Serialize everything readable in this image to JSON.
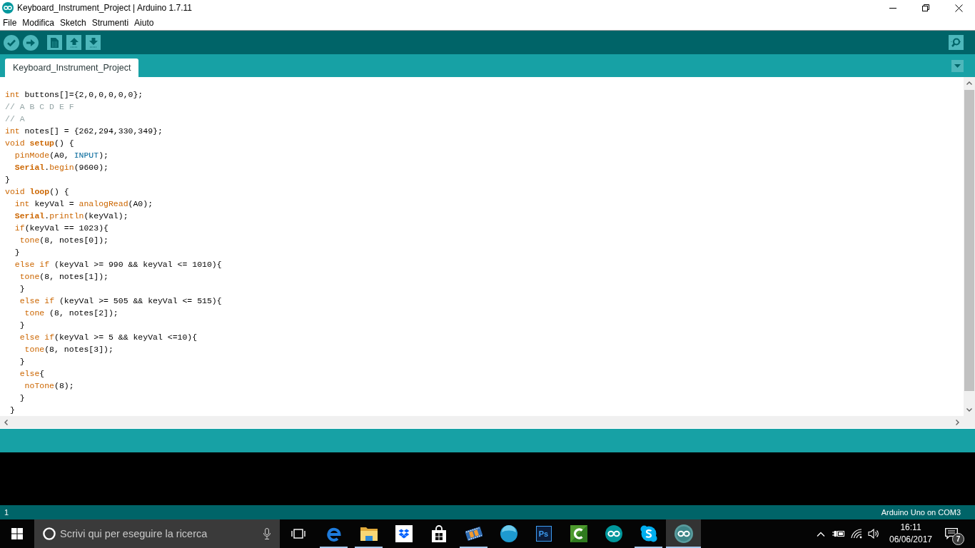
{
  "window": {
    "title": "Keyboard_Instrument_Project | Arduino 1.7.11"
  },
  "menu": [
    "File",
    "Modifica",
    "Sketch",
    "Strumenti",
    "Aiuto"
  ],
  "tabs": [
    {
      "label": "Keyboard_Instrument_Project",
      "selected": true
    }
  ],
  "editor": {
    "lines": [
      {
        "tokens": [
          {
            "text": "int",
            "kind": "keyword"
          },
          {
            "text": " buttons[]={2,0,0,0,0,0};",
            "kind": "plain"
          }
        ]
      },
      {
        "tokens": [
          {
            "text": "// A B C D E F",
            "kind": "comment"
          }
        ]
      },
      {
        "tokens": [
          {
            "text": "// A",
            "kind": "comment"
          }
        ]
      },
      {
        "tokens": [
          {
            "text": "int",
            "kind": "keyword"
          },
          {
            "text": " notes[] = {262,294,330,349};",
            "kind": "plain"
          }
        ]
      },
      {
        "tokens": [
          {
            "text": "void ",
            "kind": "keyword"
          },
          {
            "text": "setup",
            "kind": "emphasis"
          },
          {
            "text": "() {",
            "kind": "plain"
          }
        ]
      },
      {
        "tokens": [
          {
            "text": "  pinMode",
            "kind": "keyword"
          },
          {
            "text": "(A0, ",
            "kind": "plain"
          },
          {
            "text": "INPUT",
            "kind": "constant"
          },
          {
            "text": ");",
            "kind": "plain"
          }
        ]
      },
      {
        "tokens": [
          {
            "text": "  Serial",
            "kind": "emphasis"
          },
          {
            "text": ".",
            "kind": "plain"
          },
          {
            "text": "begin",
            "kind": "keyword"
          },
          {
            "text": "(9600);",
            "kind": "plain"
          }
        ]
      },
      {
        "tokens": [
          {
            "text": "}",
            "kind": "plain"
          }
        ]
      },
      {
        "tokens": [
          {
            "text": "void ",
            "kind": "keyword"
          },
          {
            "text": "loop",
            "kind": "emphasis"
          },
          {
            "text": "() {",
            "kind": "plain"
          }
        ]
      },
      {
        "tokens": [
          {
            "text": "  int",
            "kind": "keyword"
          },
          {
            "text": " keyVal = ",
            "kind": "plain"
          },
          {
            "text": "analogRead",
            "kind": "keyword"
          },
          {
            "text": "(A0);",
            "kind": "plain"
          }
        ]
      },
      {
        "tokens": [
          {
            "text": "  Serial",
            "kind": "emphasis"
          },
          {
            "text": ".",
            "kind": "plain"
          },
          {
            "text": "println",
            "kind": "keyword"
          },
          {
            "text": "(keyVal);",
            "kind": "plain"
          }
        ]
      },
      {
        "tokens": [
          {
            "text": "  if",
            "kind": "keyword"
          },
          {
            "text": "(keyVal == 1023){",
            "kind": "plain"
          }
        ]
      },
      {
        "tokens": [
          {
            "text": "   tone",
            "kind": "keyword"
          },
          {
            "text": "(8, notes[0]);",
            "kind": "plain"
          }
        ]
      },
      {
        "tokens": [
          {
            "text": "  }",
            "kind": "plain"
          }
        ]
      },
      {
        "tokens": [
          {
            "text": "  else if",
            "kind": "keyword"
          },
          {
            "text": " (keyVal >= 990 && keyVal <= 1010){",
            "kind": "plain"
          }
        ]
      },
      {
        "tokens": [
          {
            "text": "   tone",
            "kind": "keyword"
          },
          {
            "text": "(8, notes[1]);",
            "kind": "plain"
          }
        ]
      },
      {
        "tokens": [
          {
            "text": "   }",
            "kind": "plain"
          }
        ]
      },
      {
        "tokens": [
          {
            "text": "   else if",
            "kind": "keyword"
          },
          {
            "text": " (keyVal >= 505 && keyVal <= 515){",
            "kind": "plain"
          }
        ]
      },
      {
        "tokens": [
          {
            "text": "    tone",
            "kind": "keyword"
          },
          {
            "text": " (8, notes[2]);",
            "kind": "plain"
          }
        ]
      },
      {
        "tokens": [
          {
            "text": "   }",
            "kind": "plain"
          }
        ]
      },
      {
        "tokens": [
          {
            "text": "   else if",
            "kind": "keyword"
          },
          {
            "text": "(keyVal >= 5 && keyVal <=10){",
            "kind": "plain"
          }
        ]
      },
      {
        "tokens": [
          {
            "text": "    tone",
            "kind": "keyword"
          },
          {
            "text": "(8, notes[3]);",
            "kind": "plain"
          }
        ]
      },
      {
        "tokens": [
          {
            "text": "   }",
            "kind": "plain"
          }
        ]
      },
      {
        "tokens": [
          {
            "text": "   else",
            "kind": "keyword"
          },
          {
            "text": "{",
            "kind": "plain"
          }
        ]
      },
      {
        "tokens": [
          {
            "text": "    noTone",
            "kind": "keyword"
          },
          {
            "text": "(8);",
            "kind": "plain"
          }
        ]
      },
      {
        "tokens": [
          {
            "text": "   }",
            "kind": "plain"
          }
        ]
      },
      {
        "tokens": [
          {
            "text": " }",
            "kind": "plain"
          }
        ]
      }
    ]
  },
  "status_bar": {
    "line": "1",
    "board": "Arduino Uno on COM3"
  },
  "taskbar": {
    "search": {
      "placeholder": "Scrivi qui per eseguire la ricerca"
    },
    "apps": [
      {
        "kind": "letter_e",
        "running": true,
        "selected": false
      },
      {
        "kind": "folder",
        "running": true,
        "selected": false
      },
      {
        "kind": "box",
        "running": false,
        "selected": false
      },
      {
        "kind": "bag",
        "running": false,
        "selected": false
      },
      {
        "kind": "film",
        "running": true,
        "selected": false
      },
      {
        "kind": "sphere",
        "running": false,
        "selected": false
      },
      {
        "kind": "ps_tile",
        "label": "Ps",
        "running": false,
        "selected": false
      },
      {
        "kind": "c_tile",
        "running": false,
        "selected": false
      },
      {
        "kind": "infinity_teal",
        "running": false,
        "selected": false
      },
      {
        "kind": "s_bubble",
        "running": true,
        "selected": false
      },
      {
        "kind": "infinity_grey",
        "running": true,
        "selected": true
      }
    ],
    "clock": {
      "time": "16:11",
      "date": "06/06/2017"
    },
    "notifications": {
      "badge": "7"
    }
  }
}
